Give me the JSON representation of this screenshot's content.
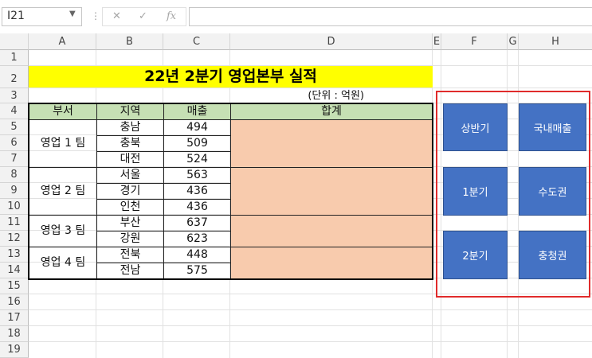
{
  "formula_bar": {
    "name_box": "I21",
    "cancel_icon": "cancel-icon",
    "enter_icon": "check-icon",
    "fx_label": "fx",
    "formula": ""
  },
  "sheet": {
    "columns": [
      "A",
      "B",
      "C",
      "D",
      "E",
      "F",
      "G",
      "H"
    ],
    "rows": [
      "1",
      "2",
      "3",
      "4",
      "5",
      "6",
      "7",
      "8",
      "9",
      "10",
      "11",
      "12",
      "13",
      "14",
      "15",
      "16",
      "17",
      "18",
      "19"
    ],
    "title": "22년 2분기 영업본부 실적",
    "unit": "(단위 : 억원)",
    "headers": {
      "dept": "부서",
      "region": "지역",
      "sales": "매출",
      "total": "합계"
    },
    "teams": [
      {
        "name": "영업 1 팀",
        "rows": [
          {
            "region": "충남",
            "sales": "494"
          },
          {
            "region": "충북",
            "sales": "509"
          },
          {
            "region": "대전",
            "sales": "524"
          }
        ]
      },
      {
        "name": "영업 2 팀",
        "rows": [
          {
            "region": "서울",
            "sales": "563"
          },
          {
            "region": "경기",
            "sales": "436"
          },
          {
            "region": "인천",
            "sales": "436"
          }
        ]
      },
      {
        "name": "영업 3 팀",
        "rows": [
          {
            "region": "부산",
            "sales": "637"
          },
          {
            "region": "강원",
            "sales": "623"
          }
        ]
      },
      {
        "name": "영업 4 팀",
        "rows": [
          {
            "region": "전북",
            "sales": "448"
          },
          {
            "region": "전남",
            "sales": "575"
          }
        ]
      }
    ]
  },
  "buttons": {
    "first_half": "상반기",
    "domestic_sales": "국내매출",
    "q1": "1분기",
    "capital_area": "수도권",
    "q2": "2분기",
    "chungcheong": "충청권"
  },
  "colors": {
    "title_fill": "#ffff00",
    "header_fill": "#c6e0b4",
    "total_fill": "#f8cbad",
    "button_fill": "#4472c4",
    "highlight_border": "#e02b2b"
  }
}
